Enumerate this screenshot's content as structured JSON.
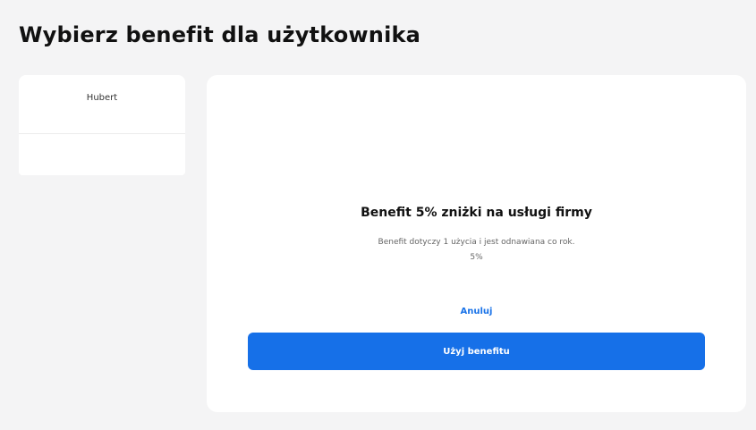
{
  "page": {
    "title": "Wybierz benefit dla użytkownika"
  },
  "users": [
    {
      "name": "Hubert"
    },
    {
      "name": ""
    }
  ],
  "benefit": {
    "title": "Benefit 5% zniżki na usługi firmy",
    "description": "Benefit dotyczy 1 użycia i jest odnawiana co rok.",
    "value": "5%",
    "cancel_label": "Anuluj",
    "use_label": "Użyj benefitu"
  },
  "colors": {
    "accent": "#1670e8",
    "background": "#f4f4f5",
    "card": "#ffffff"
  }
}
